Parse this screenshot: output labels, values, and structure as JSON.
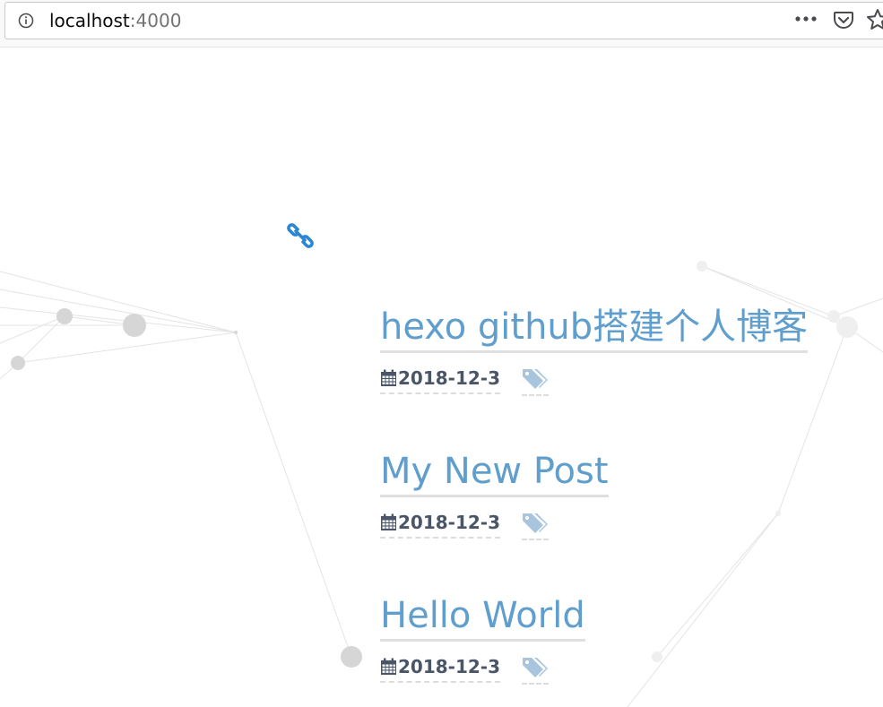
{
  "browser": {
    "url_host": "localhost",
    "url_port": ":4000",
    "icons": {
      "info": "info-icon",
      "more": "more-icon",
      "pocket": "pocket-icon",
      "bookmark": "star-icon"
    }
  },
  "page": {
    "link_icon": "link-icon",
    "posts": [
      {
        "title": "hexo github搭建个人博客",
        "date": "2018-12-3"
      },
      {
        "title": "My New Post",
        "date": "2018-12-3"
      },
      {
        "title": "Hello World",
        "date": "2018-12-3"
      }
    ]
  },
  "colors": {
    "title": "#5f9ecd",
    "date": "#4a5568",
    "tag": "#a9c4dd",
    "link_icon": "#2b86d6",
    "particle": "#d8d8d8"
  }
}
